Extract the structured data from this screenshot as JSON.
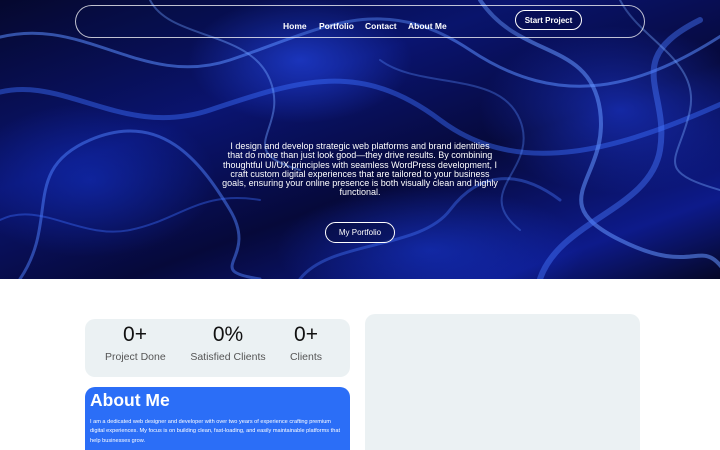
{
  "nav": {
    "links": [
      {
        "label": "Home"
      },
      {
        "label": "Portfolio"
      },
      {
        "label": "Contact"
      },
      {
        "label": "About Me"
      }
    ],
    "cta_label": "Start Project"
  },
  "hero": {
    "text": "I design and develop strategic web platforms and brand identities that do more than just look good—they drive results. By combining thoughtful UI/UX principles with seamless WordPress development, I craft custom digital experiences that are tailored to your business goals, ensuring your online presence is both visually clean and highly functional.",
    "button_label": "My Portfolio"
  },
  "stats": [
    {
      "value": "0+",
      "label": "Project Done"
    },
    {
      "value": "0%",
      "label": "Satisfied Clients"
    },
    {
      "value": "0+",
      "label": "Clients"
    }
  ],
  "about": {
    "title": "About Me",
    "text": "I am a dedicated web designer and developer with over two years of experience crafting premium digital experiences. My focus is on building clean, fast-loading, and easily maintainable platforms that help businesses grow."
  },
  "colors": {
    "hero_background": "#0a1470",
    "accent": "#2b6ef7",
    "card_background": "#ebf1f3"
  }
}
